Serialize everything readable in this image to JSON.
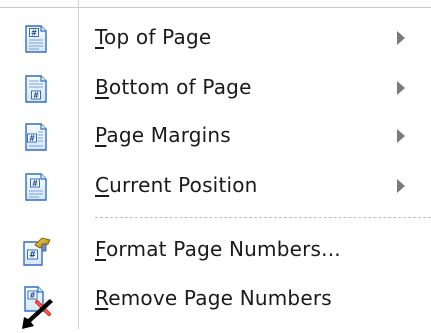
{
  "menu": {
    "items": [
      {
        "mnemonic": "T",
        "rest": "op of Page",
        "has_submenu": true,
        "icon": "page-number-top-icon"
      },
      {
        "mnemonic": "B",
        "rest": "ottom of Page",
        "has_submenu": true,
        "icon": "page-number-bottom-icon"
      },
      {
        "mnemonic": "P",
        "rest": "age Margins",
        "has_submenu": true,
        "icon": "page-margins-icon"
      },
      {
        "mnemonic": "C",
        "rest": "urrent Position",
        "has_submenu": true,
        "icon": "current-position-icon"
      },
      {
        "mnemonic": "F",
        "rest": "ormat Page Numbers...",
        "has_submenu": false,
        "icon": "format-page-numbers-icon"
      },
      {
        "mnemonic": "R",
        "rest": "emove Page Numbers",
        "has_submenu": false,
        "icon": "remove-page-numbers-icon"
      }
    ]
  },
  "colors": {
    "accent_blue": "#2f6fc4",
    "remove_red": "#e0302a",
    "format_gold": "#c79a12",
    "text": "#1a1a1a",
    "arrow": "#7a7a7a"
  }
}
